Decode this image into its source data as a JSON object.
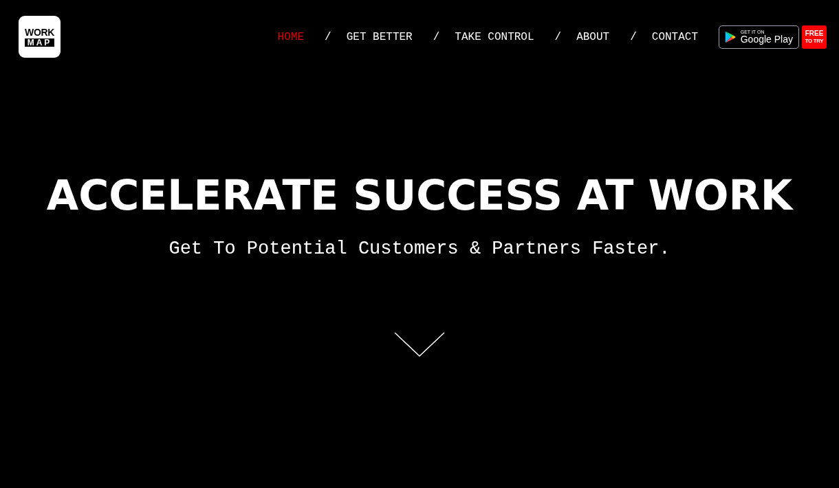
{
  "logo": {
    "line_1": "WORK",
    "line_2": "MAP"
  },
  "nav": [
    {
      "label": "HOME",
      "selected": true
    },
    {
      "separator": "/",
      "label": "GET BETTER",
      "selected": false
    },
    {
      "separator": "/",
      "label": "TAKE CONTROL",
      "selected": false
    },
    {
      "separator": "/",
      "label": "ABOUT",
      "selected": false
    },
    {
      "separator": "/",
      "label": "CONTACT",
      "selected": false
    }
  ],
  "store_badge": {
    "caption": "GET IT ON",
    "store": "Google Play"
  },
  "free_badge": {
    "line_1": "FREE",
    "line_2": "TO TRY"
  },
  "hero": {
    "title": "ACCELERATE SUCCESS AT WORK",
    "subtitle": "Get To Potential Customers & Partners Faster."
  }
}
